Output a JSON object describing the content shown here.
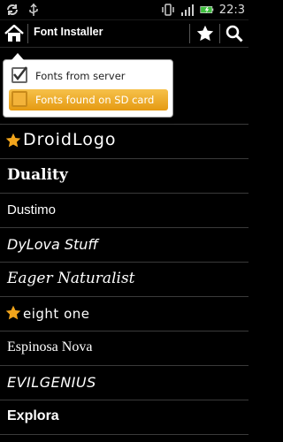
{
  "status": {
    "time": "22:3"
  },
  "header": {
    "title": "Font Installer"
  },
  "popup": {
    "items": [
      {
        "label": "Fonts from server",
        "checked": true
      },
      {
        "label": "Fonts found on SD card",
        "checked": false,
        "highlighted": true
      }
    ]
  },
  "fonts": [
    {
      "name": "DroidLogo",
      "favorite": true
    },
    {
      "name": "Duality",
      "favorite": false
    },
    {
      "name": "Dustimo",
      "favorite": false
    },
    {
      "name": "DyLova Stuff",
      "favorite": false
    },
    {
      "name": "Eager Naturalist",
      "favorite": false
    },
    {
      "name": "eight one",
      "favorite": true
    },
    {
      "name": "Espinosa Nova",
      "favorite": false
    },
    {
      "name": "EVILGENIUS",
      "favorite": false
    },
    {
      "name": "Explora",
      "favorite": false
    }
  ],
  "colors": {
    "accent": "#f0a92a",
    "star": "#f2a51c"
  }
}
